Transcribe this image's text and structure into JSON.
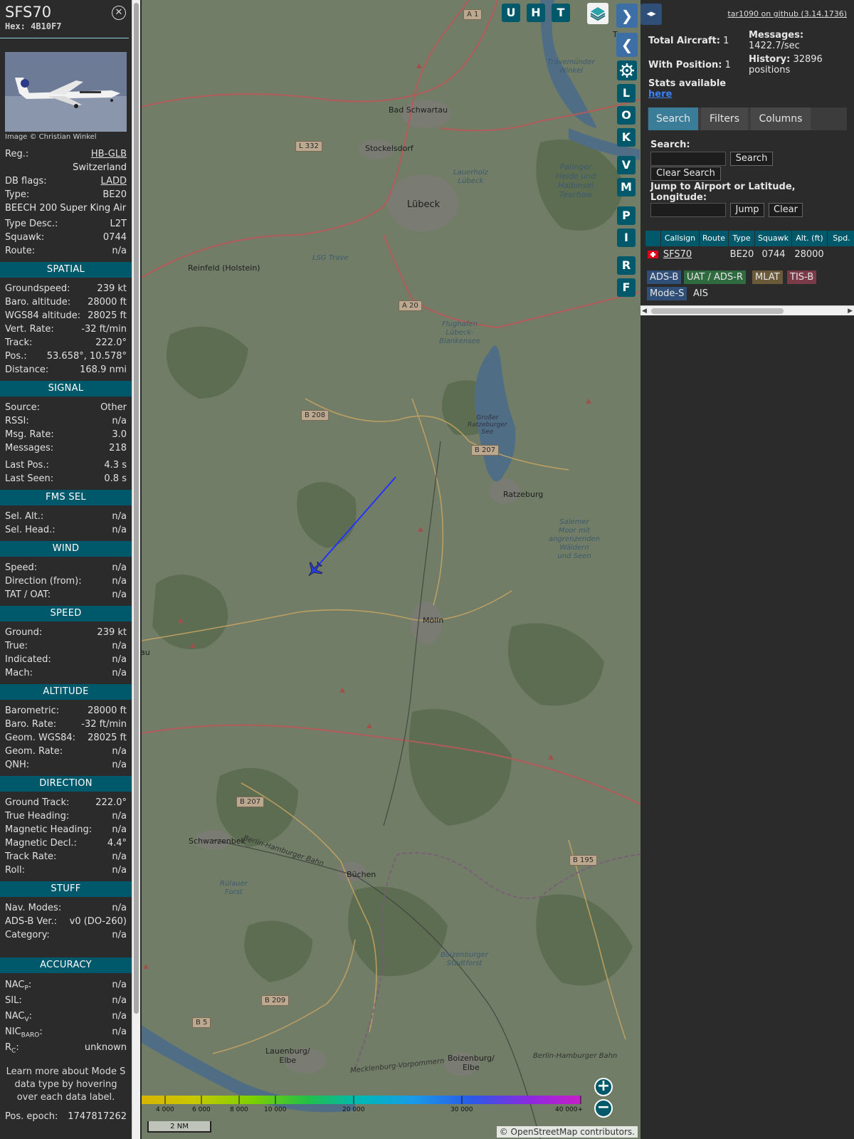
{
  "aircraft": {
    "callsign": "SFS70",
    "hex_label": "Hex: 4B10F7",
    "image_credit": "Image © Christian Winkel",
    "reg_label": "Reg.:",
    "reg": "HB-GLB",
    "country": "Switzerland",
    "db_flags_label": "DB flags:",
    "db_flags": "LADD",
    "type_label": "Type:",
    "type": "BE20",
    "type_full": "BEECH 200 Super King Air",
    "type_desc_label": "Type Desc.:",
    "type_desc": "L2T",
    "squawk_label": "Squawk:",
    "squawk": "0744",
    "route_label": "Route:",
    "route": "n/a"
  },
  "sections": {
    "spatial": {
      "title": "SPATIAL",
      "rows": [
        {
          "label": "Groundspeed:",
          "value": "239 kt"
        },
        {
          "label": "Baro. altitude:",
          "value": "28000 ft"
        },
        {
          "label": "WGS84 altitude:",
          "value": "28025 ft"
        },
        {
          "label": "Vert. Rate:",
          "value": "-32 ft/min"
        },
        {
          "label": "Track:",
          "value": "222.0°"
        },
        {
          "label": "Pos.:",
          "value": "53.658°, 10.578°"
        },
        {
          "label": "Distance:",
          "value": "168.9 nmi"
        }
      ]
    },
    "signal": {
      "title": "SIGNAL",
      "rows": [
        {
          "label": "Source:",
          "value": "Other"
        },
        {
          "label": "RSSI:",
          "value": "n/a"
        },
        {
          "label": "Msg. Rate:",
          "value": "3.0"
        },
        {
          "label": "Messages:",
          "value": "218"
        }
      ],
      "rows2": [
        {
          "label": "Last Pos.:",
          "value": "4.3 s"
        },
        {
          "label": "Last Seen:",
          "value": "0.8 s"
        }
      ]
    },
    "fms": {
      "title": "FMS SEL",
      "rows": [
        {
          "label": "Sel. Alt.:",
          "value": "n/a"
        },
        {
          "label": "Sel. Head.:",
          "value": "n/a"
        }
      ]
    },
    "wind": {
      "title": "WIND",
      "rows": [
        {
          "label": "Speed:",
          "value": "n/a"
        },
        {
          "label": "Direction (from):",
          "value": "n/a"
        },
        {
          "label": "TAT / OAT:",
          "value": "n/a"
        }
      ]
    },
    "speed": {
      "title": "SPEED",
      "rows": [
        {
          "label": "Ground:",
          "value": "239 kt"
        },
        {
          "label": "True:",
          "value": "n/a"
        },
        {
          "label": "Indicated:",
          "value": "n/a"
        },
        {
          "label": "Mach:",
          "value": "n/a"
        }
      ]
    },
    "altitude": {
      "title": "ALTITUDE",
      "rows": [
        {
          "label": "Barometric:",
          "value": "28000 ft"
        },
        {
          "label": "Baro. Rate:",
          "value": "-32 ft/min"
        },
        {
          "label": "Geom. WGS84:",
          "value": "28025 ft"
        },
        {
          "label": "Geom. Rate:",
          "value": "n/a"
        },
        {
          "label": "QNH:",
          "value": "n/a"
        }
      ]
    },
    "direction": {
      "title": "DIRECTION",
      "rows": [
        {
          "label": "Ground Track:",
          "value": "222.0°"
        },
        {
          "label": "True Heading:",
          "value": "n/a"
        },
        {
          "label": "Magnetic Heading:",
          "value": "n/a"
        },
        {
          "label": "Magnetic Decl.:",
          "value": "4.4°"
        },
        {
          "label": "Track Rate:",
          "value": "n/a"
        },
        {
          "label": "Roll:",
          "value": "n/a"
        }
      ]
    },
    "stuff": {
      "title": "STUFF",
      "rows": [
        {
          "label": "Nav. Modes:",
          "value": "n/a"
        },
        {
          "label": "ADS-B Ver.:",
          "value": "v0 (DO-260)"
        },
        {
          "label": "Category:",
          "value": "n/a"
        }
      ]
    },
    "accuracy": {
      "title": "ACCURACY",
      "nacp": {
        "base": "NAC",
        "sub": "P",
        "colon": ":",
        "value": "n/a"
      },
      "sil": {
        "label": "SIL:",
        "value": "n/a"
      },
      "nacv": {
        "base": "NAC",
        "sub": "V",
        "colon": ":",
        "value": "n/a"
      },
      "nicbaro": {
        "base": "NIC",
        "sub": "BARO",
        "colon": ":",
        "value": "n/a"
      },
      "rc": {
        "base": "R",
        "sub": "C",
        "colon": ":",
        "value": "unknown"
      }
    },
    "note": "Learn more about Mode S data type by hovering over each data label.",
    "epoch": {
      "label": "Pos. epoch:",
      "value": "1747817262"
    }
  },
  "map": {
    "toolbar_top": [
      "U",
      "H",
      "T"
    ],
    "side_buttons": [
      "L",
      "O",
      "K",
      "V",
      "M",
      "P",
      "I",
      "R",
      "F"
    ],
    "nav": {
      "forward": "❯",
      "back": "❮",
      "expand": "◂▸"
    },
    "settings_icon": "gear-icon",
    "layers_icon": "layers-icon",
    "zoom_in": "+",
    "zoom_out": "−",
    "scale": "2 NM",
    "attribution_prefix": "©",
    "attribution_link": "OpenStreetMap",
    "attribution_suffix": "contributors.",
    "altitude_legend": [
      "4 000",
      "6 000",
      "8 000",
      "10 000",
      "20 000",
      "30 000",
      "40 000+"
    ],
    "places": {
      "luebeck": "Lübeck",
      "bad_schwartau": "Bad Schwartau",
      "stockelsdorf": "Stockelsdorf",
      "reinfeld": "Reinfeld (Holstein)",
      "ratzeburg": "Ratzeburg",
      "moelln": "Mölln",
      "schwarzenbek": "Schwarzenbek",
      "buechen": "Büchen",
      "lauenburg": "Lauenburg/\nElbe",
      "boizenburg": "Boizenburg/\nElbe",
      "travemuender": "Travemünder\nWinkel",
      "palinger": "Palinger\nHeide und\nHalbinsel\nTeschow",
      "lauerholz": "Lauerholz\nLübeck",
      "flughafen": "Flughafen\nLübeck-\nBlankensee",
      "lsg_trave": "LSG Trave",
      "grosser_see": "Großer\nRatzeburger\nSee",
      "salemer": "Salemer\nMoor mit\nangrenzenden\nWäldern\nund Seen",
      "ruelauer": "Rülauer\nForst",
      "boizenburger_forst": "Boizenburger\nStadtforst",
      "berlin_hamburger_bahn_w": "Berlin-Hamburger Bahn",
      "berlin_hamburger_bahn_e": "Berlin-Hamburger Bahn",
      "mecklenburg": "Mecklenburg-Vorpommern",
      "trav_partial": "Trav",
      "au_partial": "au"
    },
    "roads": {
      "a1": "A 1",
      "l332": "L 332",
      "a20": "A 20",
      "b208": "B 208",
      "b207_n": "B 207",
      "b207_s": "B 207",
      "b195": "B 195",
      "b209": "B 209",
      "b5": "B 5"
    },
    "colors": {
      "track": "#2233ff",
      "aircraft": "#2a3bd6",
      "panel_accent": "#00596b"
    }
  },
  "right": {
    "tar_link": "tar1090 on github (3.14.1736)",
    "total_aircraft_label": "Total Aircraft:",
    "total_aircraft": "1",
    "with_position_label": "With Position:",
    "with_position": "1",
    "stats_label": "Stats available",
    "stats_link": "here",
    "messages_label": "Messages:",
    "messages_rate": "1422.7/sec",
    "history_label": "History:",
    "history_value": "32896",
    "history_unit": "positions",
    "tabs": [
      "Search",
      "Filters",
      "Columns"
    ],
    "search_label": "Search:",
    "search_value": "",
    "search_button": "Search",
    "clear_search_button": "Clear Search",
    "jump_label": "Jump to Airport or Latitude, Longitude:",
    "jump_value": "",
    "jump_button": "Jump",
    "clear_button": "Clear",
    "table": {
      "columns": [
        "",
        "Callsign",
        "Route",
        "Type",
        "Squawk",
        "Alt. (ft)",
        "Spd."
      ],
      "row": {
        "callsign": "SFS70",
        "route": "",
        "type": "BE20",
        "squawk": "0744",
        "alt": "28000",
        "spd": ""
      }
    },
    "sources": [
      {
        "label": "ADS-B",
        "color": "#2f4f78"
      },
      {
        "label": "UAT / ADS-R",
        "color": "#2f6b3e"
      },
      {
        "label": "MLAT",
        "color": "#6b5a3a"
      },
      {
        "label": "TIS-B",
        "color": "#7a3a48"
      },
      {
        "label": "Mode-S",
        "color": "#2f4f78"
      },
      {
        "label": "AIS",
        "color": "#2b2b2b"
      }
    ]
  }
}
